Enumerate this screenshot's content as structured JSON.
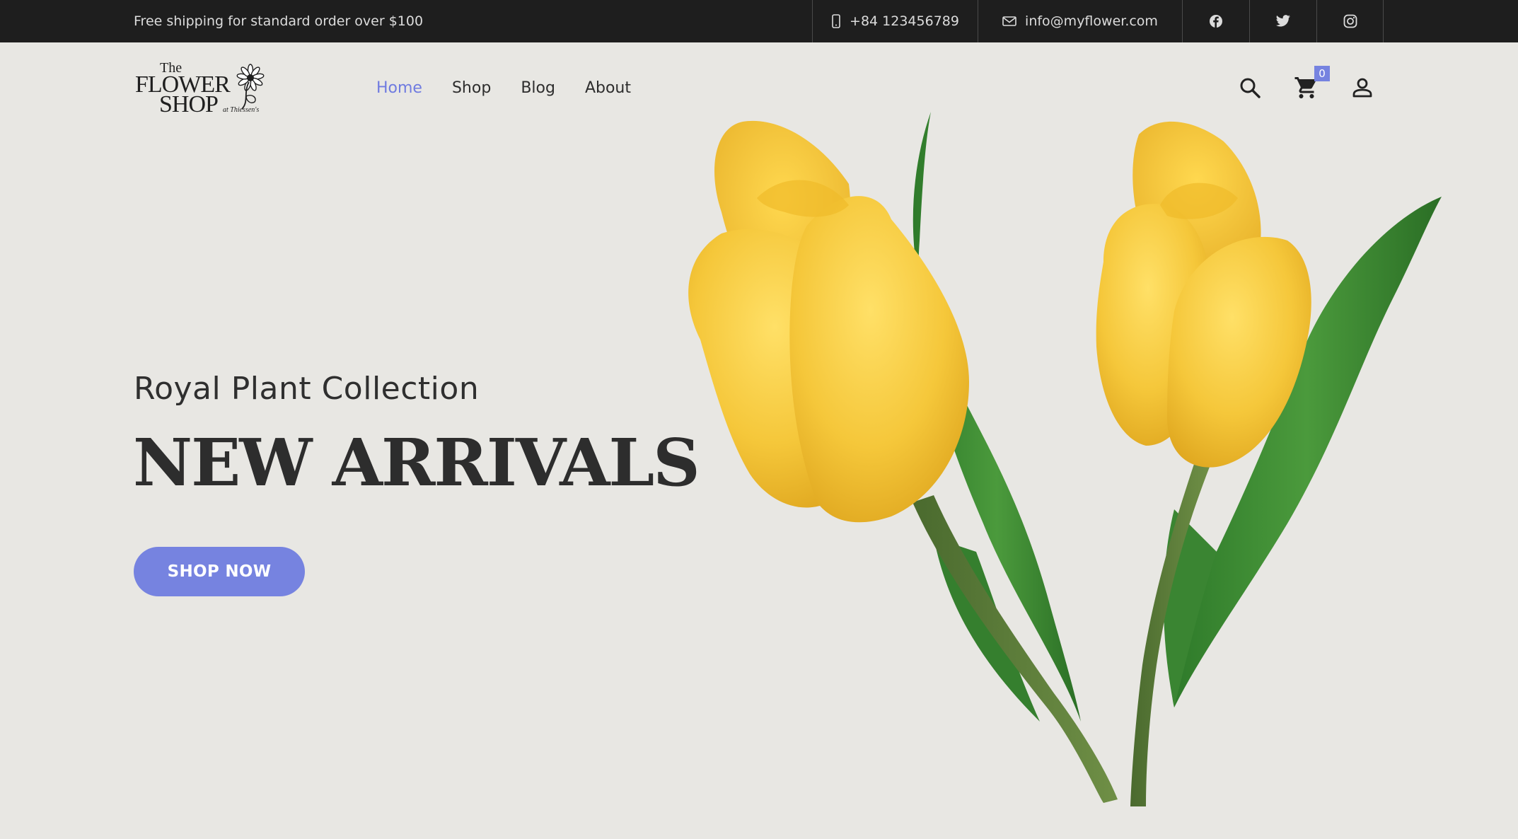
{
  "topbar": {
    "promo": "Free shipping for standard order over $100",
    "phone": "+84 123456789",
    "email": "info@myflower.com",
    "socials": [
      {
        "icon": "facebook-icon"
      },
      {
        "icon": "twitter-icon"
      },
      {
        "icon": "instagram-icon"
      }
    ]
  },
  "header": {
    "logo": {
      "line1": "The",
      "line2": "FLOWER",
      "line3": "SHOP",
      "line4": "at Thiessen's"
    },
    "nav": [
      {
        "label": "Home",
        "active": true
      },
      {
        "label": "Shop",
        "active": false
      },
      {
        "label": "Blog",
        "active": false
      },
      {
        "label": "About",
        "active": false
      }
    ],
    "icons": [
      "search-icon",
      "cart-icon",
      "user-icon"
    ],
    "cart_count": "0"
  },
  "hero": {
    "subtitle": "Royal Plant Collection",
    "title": "NEW ARRIVALS",
    "cta": "SHOP NOW",
    "image": "yellow-tulips"
  },
  "colors": {
    "accent": "#7683e0",
    "topbar_bg": "#1e1e1e",
    "page_bg": "#e8e7e3",
    "text": "#2d2d2d"
  }
}
